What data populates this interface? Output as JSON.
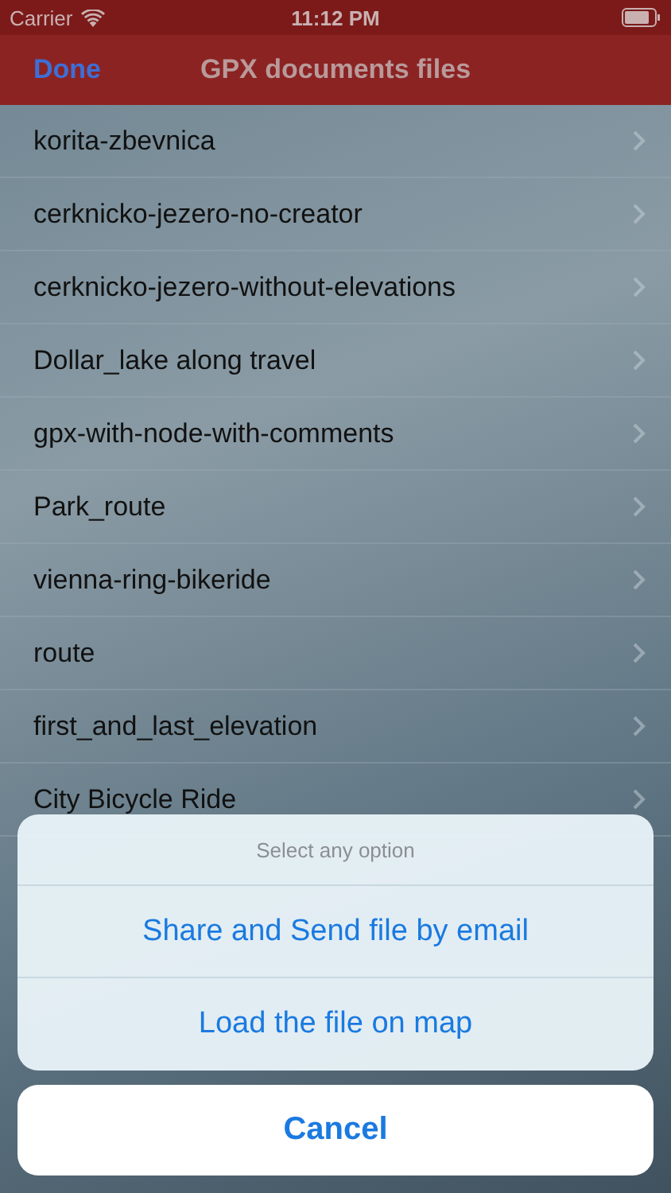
{
  "status_bar": {
    "carrier": "Carrier",
    "time": "11:12 PM"
  },
  "nav_bar": {
    "done": "Done",
    "title": "GPX documents files"
  },
  "files": [
    {
      "name": "korita-zbevnica"
    },
    {
      "name": "cerknicko-jezero-no-creator"
    },
    {
      "name": "cerknicko-jezero-without-elevations"
    },
    {
      "name": "Dollar_lake along travel"
    },
    {
      "name": "gpx-with-node-with-comments"
    },
    {
      "name": "Park_route"
    },
    {
      "name": "vienna-ring-bikeride"
    },
    {
      "name": "route"
    },
    {
      "name": "first_and_last_elevation"
    },
    {
      "name": "City Bicycle Ride"
    }
  ],
  "action_sheet": {
    "title": "Select any option",
    "actions": [
      "Share and Send file by email",
      "Load the file on map"
    ],
    "cancel": "Cancel"
  }
}
